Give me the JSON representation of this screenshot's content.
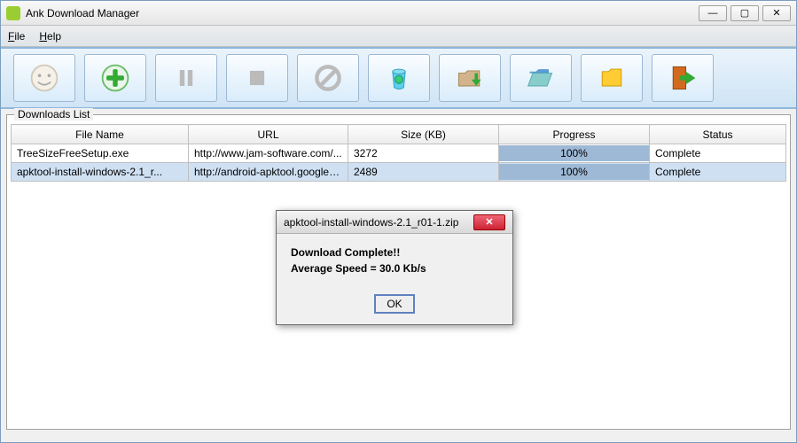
{
  "app_title": "Ank Download Manager",
  "menu": {
    "file": "File",
    "help": "Help"
  },
  "group_label": "Downloads List",
  "columns": {
    "file": "File Name",
    "url": "URL",
    "size": "Size (KB)",
    "progress": "Progress",
    "status": "Status"
  },
  "rows": [
    {
      "file": "TreeSizeFreeSetup.exe",
      "url": "http://www.jam-software.com/...",
      "size": "3272",
      "progress": "100%",
      "status": "Complete",
      "selected": false
    },
    {
      "file": "apktool-install-windows-2.1_r...",
      "url": "http://android-apktool.googlec...",
      "size": "2489",
      "progress": "100%",
      "status": "Complete",
      "selected": true
    }
  ],
  "dialog": {
    "title": "apktool-install-windows-2.1_r01-1.zip",
    "line1": "Download Complete!!",
    "line2": "Average Speed = 30.0 Kb/s",
    "ok": "OK"
  }
}
